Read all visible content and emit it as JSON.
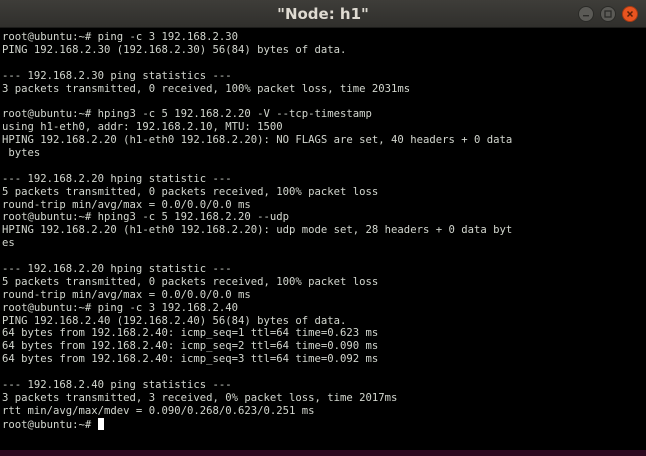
{
  "window": {
    "title": "\"Node: h1\"",
    "min_icon": "minimize-icon",
    "max_icon": "maximize-icon",
    "close_icon": "close-icon",
    "close_color": "#e95420"
  },
  "terminal": {
    "lines": [
      "root@ubuntu:~# ping -c 3 192.168.2.30",
      "PING 192.168.2.30 (192.168.2.30) 56(84) bytes of data.",
      "",
      "--- 192.168.2.30 ping statistics ---",
      "3 packets transmitted, 0 received, 100% packet loss, time 2031ms",
      "",
      "root@ubuntu:~# hping3 -c 5 192.168.2.20 -V --tcp-timestamp",
      "using h1-eth0, addr: 192.168.2.10, MTU: 1500",
      "HPING 192.168.2.20 (h1-eth0 192.168.2.20): NO FLAGS are set, 40 headers + 0 data",
      " bytes",
      "",
      "--- 192.168.2.20 hping statistic ---",
      "5 packets transmitted, 0 packets received, 100% packet loss",
      "round-trip min/avg/max = 0.0/0.0/0.0 ms",
      "root@ubuntu:~# hping3 -c 5 192.168.2.20 --udp",
      "HPING 192.168.2.20 (h1-eth0 192.168.2.20): udp mode set, 28 headers + 0 data byt",
      "es",
      "",
      "--- 192.168.2.20 hping statistic ---",
      "5 packets transmitted, 0 packets received, 100% packet loss",
      "round-trip min/avg/max = 0.0/0.0/0.0 ms",
      "root@ubuntu:~# ping -c 3 192.168.2.40",
      "PING 192.168.2.40 (192.168.2.40) 56(84) bytes of data.",
      "64 bytes from 192.168.2.40: icmp_seq=1 ttl=64 time=0.623 ms",
      "64 bytes from 192.168.2.40: icmp_seq=2 ttl=64 time=0.090 ms",
      "64 bytes from 192.168.2.40: icmp_seq=3 ttl=64 time=0.092 ms",
      "",
      "--- 192.168.2.40 ping statistics ---",
      "3 packets transmitted, 3 received, 0% packet loss, time 2017ms",
      "rtt min/avg/max/mdev = 0.090/0.268/0.623/0.251 ms"
    ],
    "prompt": "root@ubuntu:~# ",
    "text_color": "#d3d7cf",
    "background": "#000000"
  }
}
